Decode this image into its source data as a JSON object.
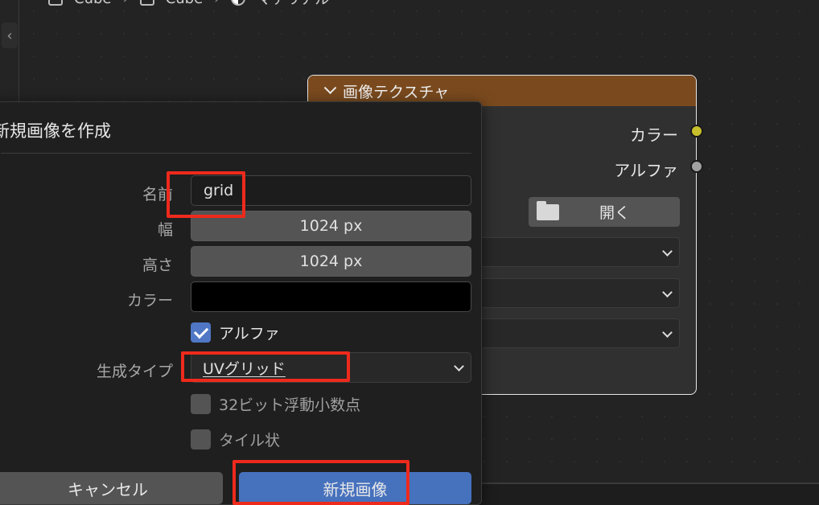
{
  "header": {
    "breadcrumb": [
      "Cube",
      "Cube",
      "マテリアル"
    ]
  },
  "node": {
    "title": "画像テクスチャ",
    "header_color": "#7a4a1e",
    "outputs": [
      {
        "label": "カラー",
        "socket_color": "#c7c02c"
      },
      {
        "label": "アルファ",
        "socket_color": "#a1a1a1"
      }
    ],
    "open_button_label": "開く"
  },
  "dialog": {
    "title": "新規画像を作成",
    "name_label": "名前",
    "name_value": "grid",
    "width_label": "幅",
    "width_value": "1024 px",
    "height_label": "高さ",
    "height_value": "1024 px",
    "color_label": "カラー",
    "color_value": "#000000",
    "alpha_label": "アルファ",
    "alpha_checked": true,
    "generated_type_label": "生成タイプ",
    "generated_type_value": "UVグリッド",
    "float_label": "32ビット浮動小数点",
    "float_checked": false,
    "tiled_label": "タイル状",
    "tiled_checked": false,
    "cancel_label": "キャンセル",
    "ok_label": "新規画像",
    "accent_color": "#4671bd"
  },
  "annotation_color": "#ee2a1c"
}
